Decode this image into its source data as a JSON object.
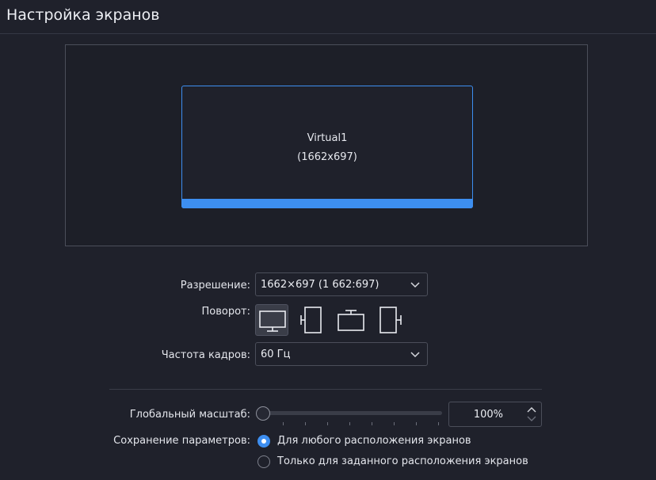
{
  "header": {
    "title": "Настройка экранов"
  },
  "screen": {
    "name": "Virtual1",
    "resolution": "(1662x697)"
  },
  "resolution": {
    "label": "Разрешение:",
    "value": "1662×697 (1 662:697)"
  },
  "rotation": {
    "label": "Поворот:",
    "options": [
      {
        "name": "landscape",
        "icon": "monitor-landscape-icon",
        "selected": true
      },
      {
        "name": "rotate-left",
        "icon": "rotate-left-icon",
        "selected": false
      },
      {
        "name": "inverted",
        "icon": "monitor-inverted-icon",
        "selected": false
      },
      {
        "name": "rotate-right",
        "icon": "rotate-right-icon",
        "selected": false
      }
    ]
  },
  "refresh": {
    "label": "Частота кадров:",
    "value": "60 Гц"
  },
  "scale": {
    "label": "Глобальный масштаб:",
    "value": "100%",
    "slider_fraction": 0.0
  },
  "save": {
    "label": "Сохранение параметров:",
    "options": [
      {
        "label": "Для любого расположения экранов",
        "selected": true
      },
      {
        "label": "Только для заданного расположения экранов",
        "selected": false
      }
    ]
  },
  "colors": {
    "accent": "#3d8ef0",
    "background": "#1f212b"
  }
}
